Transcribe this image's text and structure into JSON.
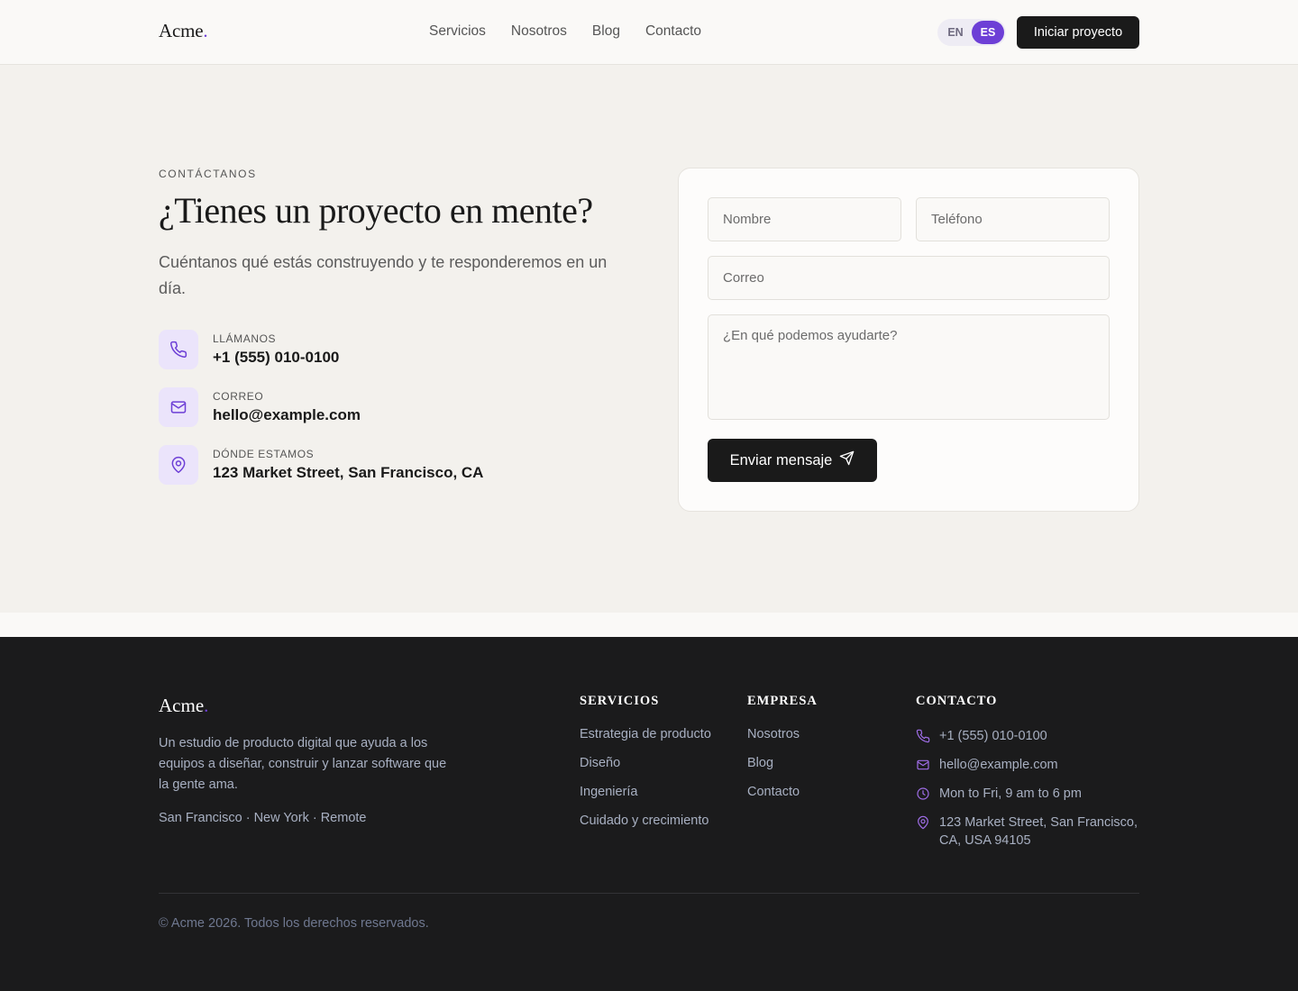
{
  "header": {
    "logo": "Acme",
    "logo_dot": ".",
    "nav": [
      "Servicios",
      "Nosotros",
      "Blog",
      "Contacto"
    ],
    "lang": {
      "en": "EN",
      "es": "ES",
      "active": "ES"
    },
    "cta": "Iniciar proyecto"
  },
  "contact": {
    "eyebrow": "CONTÁCTANOS",
    "title": "¿Tienes un proyecto en mente?",
    "lead": "Cuéntanos qué estás construyendo y te responderemos en un día.",
    "items": [
      {
        "icon": "phone-icon",
        "label": "LLÁMANOS",
        "value": "+1 (555) 010-0100"
      },
      {
        "icon": "mail-icon",
        "label": "CORREO",
        "value": "hello@example.com"
      },
      {
        "icon": "map-pin-icon",
        "label": "DÓNDE ESTAMOS",
        "value": "123 Market Street, San Francisco, CA"
      }
    ],
    "form": {
      "name_placeholder": "Nombre",
      "phone_placeholder": "Teléfono",
      "email_placeholder": "Correo",
      "message_placeholder": "¿En qué podemos ayudarte?",
      "submit": "Enviar mensaje"
    }
  },
  "footer": {
    "logo": "Acme",
    "logo_dot": ".",
    "description": "Un estudio de producto digital que ayuda a los equipos a diseñar, construir y lanzar software que la gente ama.",
    "cities": "San Francisco · New York · Remote",
    "services": {
      "title": "SERVICIOS",
      "links": [
        "Estrategia de producto",
        "Diseño",
        "Ingeniería",
        "Cuidado y crecimiento"
      ]
    },
    "company": {
      "title": "EMPRESA",
      "links": [
        "Nosotros",
        "Blog",
        "Contacto"
      ]
    },
    "contact": {
      "title": "CONTACTO",
      "items": [
        {
          "icon": "phone-icon",
          "text": "+1 (555) 010-0100"
        },
        {
          "icon": "mail-icon",
          "text": "hello@example.com"
        },
        {
          "icon": "clock-icon",
          "text": "Mon to Fri, 9 am to 6 pm"
        },
        {
          "icon": "map-pin-icon",
          "text": "123 Market Street, San Francisco, CA, USA 94105"
        }
      ]
    },
    "copyright": "© Acme 2026. Todos los derechos reservados."
  },
  "colors": {
    "accent": "#6d3fd6",
    "dark": "#1a1a1a",
    "section_bg": "#f3f1ed",
    "footer_bg": "#1b1b1c"
  }
}
